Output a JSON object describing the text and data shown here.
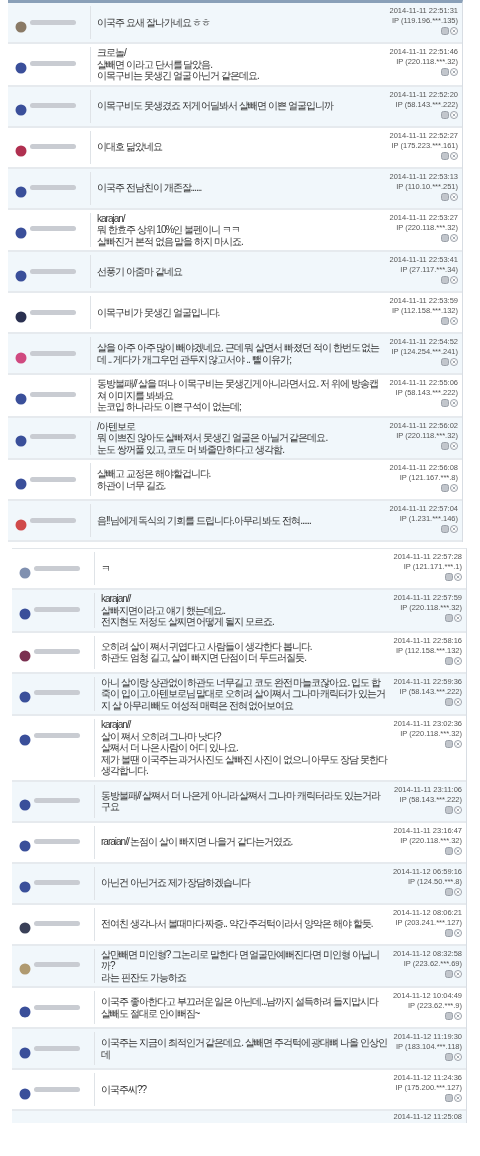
{
  "sections": [
    {
      "comments": [
        {
          "color": "#8a7a66",
          "text": "이국주 요새 잘나가네요 ㅎㅎ",
          "date": "2014-11-11 22:51:31",
          "ip": "IP (119.196.***.135)"
        },
        {
          "color": "#3a4f9a",
          "text": "크로놀/\n살빼면 이라고 단서를 달았음.\n이목구비는 못생긴 얼굴 아닌거 같은데요.",
          "date": "2014-11-11 22:51:46",
          "ip": "IP (220.118.***.32)"
        },
        {
          "color": "#3a4f9a",
          "text": "이목구비도 못생겼죠 저게 어딜봐서 살빼면 이쁜 얼굴입니까",
          "date": "2014-11-11 22:52:20",
          "ip": "IP (58.143.***.222)"
        },
        {
          "color": "#b03050",
          "text": "이대호 닮았네요",
          "date": "2014-11-11 22:52:27",
          "ip": "IP (175.223.***.161)"
        },
        {
          "color": "#3a4f9a",
          "text": "이국주 전남친이 개존잘......",
          "date": "2014-11-11 22:53:13",
          "ip": "IP (110.10.***.251)"
        },
        {
          "color": "#3a4f9a",
          "text": "karajan/\n뭐 한효주 상위 10%인 불펜이니 ㅋㅋ\n살빠진거 본적 없음 말을 하지 마시죠.",
          "date": "2014-11-11 22:53:27",
          "ip": "IP (220.118.***.32)"
        },
        {
          "color": "#3a4f9a",
          "text": "선풍기 아줌마 같네요",
          "date": "2014-11-11 22:53:41",
          "ip": "IP (27.117.***.34)"
        },
        {
          "color": "#2a3050",
          "text": "이목구비가 못생긴 얼굴입니다.",
          "date": "2014-11-11 22:53:59",
          "ip": "IP (112.158.***.132)"
        },
        {
          "color": "#d04a80",
          "text": "살을 아주 아주 많이 빼야겠네요. 근데 뭐 살면서 빠졌던 적이 한번도 없는데 .. 게다가 개그우먼 관두지 않고서야 .. 뺄 이유가;",
          "date": "2014-11-11 22:54:52",
          "ip": "IP (124.254.***.241)"
        },
        {
          "color": "#3a4f9a",
          "text": "동방불패// 살을 떠나 이목구비는 못생긴게 아니라면서요. 저 위에 방송캡쳐 이미지를 봐봐요\n눈코입 하나라도 이쁜 구석이 없는데;",
          "date": "2014-11-11 22:55:06",
          "ip": "IP (58.143.***.222)"
        },
        {
          "color": "#3a4f9a",
          "text": "/아텐보로\n뭐 이쁘진 않아도 살빠져서 못생긴 얼굴은 아닐거 같은데요.\n눈도 쌍꺼풀 있고, 코도 머 봐줄만 하다고 생각함.",
          "date": "2014-11-11 22:56:02",
          "ip": "IP (220.118.***.32)"
        },
        {
          "color": "#3a4f9a",
          "text": "살빼고 교정은 해야할겁니다.\n하관이 너무 길죠.",
          "date": "2014-11-11 22:56:08",
          "ip": "IP (121.167.***.8)"
        },
        {
          "color": "#d04a4a",
          "text": "음!!님에게 독식의 기회를 드립니다.아무리 봐도 전혀......",
          "date": "2014-11-11 22:57:04",
          "ip": "IP (1.231.***.146)"
        }
      ]
    },
    {
      "comments": [
        {
          "color": "#8090b0",
          "text": "ㅋ",
          "date": "2014-11-11 22:57:28",
          "ip": "IP (121.171.***.1)"
        },
        {
          "color": "#3a4f9a",
          "text": "karajan//\n살빠지면이라고 얘기 했는데요..\n전지현도 저정도 살찌면 어떻게 될지 모르죠.",
          "date": "2014-11-11 22:57:59",
          "ip": "IP (220.118.***.32)"
        },
        {
          "color": "#7a3050",
          "text": "오히려 살이 쪄서 귀엽다고 사람들이 생각한다 봅니다.\n하관도 엄청 길고, 살이 빠지면 단점이 더 두드러질듯.",
          "date": "2014-11-11 22:58:16",
          "ip": "IP (112.158.***.132)"
        },
        {
          "color": "#3a4f9a",
          "text": "아니 살이랑 상관없이 하관도 너무길고 코도 완전 마늘코잖아요. 입도 합죽이 입이고.아텐보로님 말대로 오히려 살이쪄서 그나마 캐릭터가 있는거지 살 아무리 빼도 여성적 매력은 전혀 없어보여요",
          "date": "2014-11-11 22:59:36",
          "ip": "IP (58.143.***.222)"
        },
        {
          "color": "#3a4f9a",
          "text": "karajan//\n살이 쪄서 오히려 그나마 낫다?\n살쪄서 더 나은 사람이 어디 있나요.\n제가 볼땐 이국주는 과거사진도 살빠진 사진이 없으니 아무도 장담 못한다 생각합니다.",
          "date": "2014-11-11 23:02:36",
          "ip": "IP (220.118.***.32)"
        },
        {
          "color": "#3a4f9a",
          "text": "동방불패// 살쪄서 더 나은게 아니라 살쪄서 그나마 캐릭터라도 있는거라구요",
          "date": "2014-11-11 23:11:06",
          "ip": "IP (58.143.***.222)"
        },
        {
          "color": "#3a4f9a",
          "text": "raraian// 논점이 살이 빠지면 나을거 같다는거였죠.",
          "date": "2014-11-11 23:16:47",
          "ip": "IP (220.118.***.32)"
        },
        {
          "color": "#3a4f9a",
          "text": "아닌건 아닌거죠 제가 장담하겠습니다",
          "date": "2014-11-12 06:59:16",
          "ip": "IP (124.50.***.8)"
        },
        {
          "color": "#3a4058",
          "text": "전여친 생각나서 볼때마다 짜증.. 약간 주걱턱이라서 양악은 해야 할듯.",
          "date": "2014-11-12 08:06:21",
          "ip": "IP (203.241.***.127)"
        },
        {
          "color": "#b09a70",
          "text": "살만빼면 미인형? 그논리로 말한다 면 얼굴만예뻐진다면 미인형 아닙니까?\n라는 핀잔도 가능하죠",
          "date": "2014-11-12 08:32:58",
          "ip": "IP (223.62.***.69)"
        },
        {
          "color": "#3a4f9a",
          "text": "이국주 좋아한다고 부끄러운 일은 아닌데...남까지 설득하려 들지맙시다\n살빼도 절대로 안이뻐짐~",
          "date": "2014-11-12 10:04:49",
          "ip": "IP (223.62.***.9)"
        },
        {
          "color": "#3a4f9a",
          "text": "이국주는 지금이 최적인거 같은데요. 살빼면 주걱턱에 광대뼈 나올 인상인데",
          "date": "2014-11-12 11:19:30",
          "ip": "IP (183.104.***.118)"
        },
        {
          "color": "#3a4f9a",
          "text": "이국주씨??",
          "date": "2014-11-12 11:24:36",
          "ip": "IP (175.200.***.127)"
        },
        {
          "date": "2014-11-12 11:25:08"
        }
      ]
    }
  ]
}
